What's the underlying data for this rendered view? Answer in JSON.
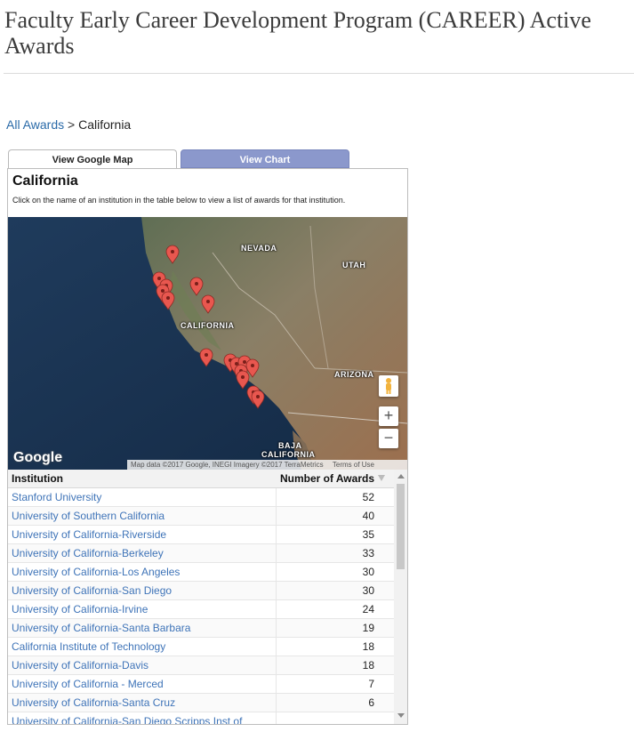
{
  "page": {
    "title": "Faculty Early Career Development Program (CAREER) Active Awards"
  },
  "breadcrumb": {
    "parent": "All Awards",
    "separator": ">",
    "current": "California"
  },
  "tabs": {
    "map_label": "View Google Map",
    "chart_label": "View Chart"
  },
  "panel": {
    "title": "California",
    "description": "Click on the name of an institution in the table below to view a list of awards for that institution."
  },
  "map": {
    "labels": {
      "nevada": "NEVADA",
      "utah": "UTAH",
      "california": "CALIFORNIA",
      "arizona": "ARIZONA",
      "baja": "BAJA",
      "baja2": "CALIFORNIA"
    },
    "google_logo": "Google",
    "attribution": "Map data ©2017 Google, INEGI Imagery ©2017 TerraMetrics",
    "terms": "Terms of Use",
    "zoom_in": "+",
    "zoom_out": "−",
    "icons": {
      "pegman": "pegman-icon",
      "marker": "map-marker-icon"
    }
  },
  "table": {
    "headers": {
      "institution": "Institution",
      "awards": "Number of Awards"
    },
    "rows": [
      {
        "institution": "Stanford University",
        "awards": "52"
      },
      {
        "institution": "University of Southern California",
        "awards": "40"
      },
      {
        "institution": "University of California-Riverside",
        "awards": "35"
      },
      {
        "institution": "University of California-Berkeley",
        "awards": "33"
      },
      {
        "institution": "University of California-Los Angeles",
        "awards": "30"
      },
      {
        "institution": "University of California-San Diego",
        "awards": "30"
      },
      {
        "institution": "University of California-Irvine",
        "awards": "24"
      },
      {
        "institution": "University of California-Santa Barbara",
        "awards": "19"
      },
      {
        "institution": "California Institute of Technology",
        "awards": "18"
      },
      {
        "institution": "University of California-Davis",
        "awards": "18"
      },
      {
        "institution": "University of California - Merced",
        "awards": "7"
      },
      {
        "institution": "University of California-Santa Cruz",
        "awards": "6"
      },
      {
        "institution": "University of California-San Diego Scripps Inst of",
        "awards": ""
      }
    ]
  },
  "colors": {
    "link": "#3f74b8",
    "chart_tab": "#8b98cc",
    "marker": "#e8574f"
  }
}
